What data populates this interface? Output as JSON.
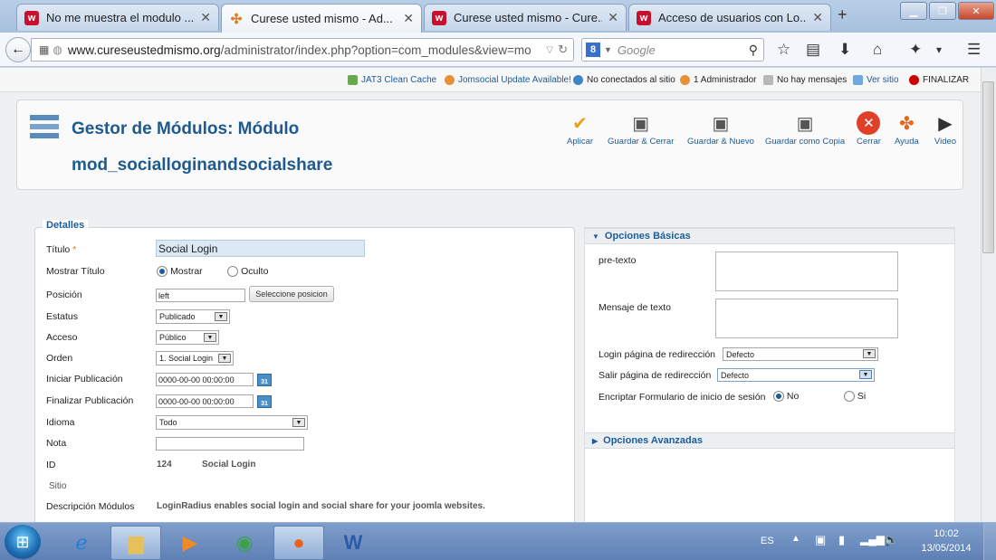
{
  "browser": {
    "tabs": [
      {
        "title": "No me muestra el modulo ...",
        "icon": "web-icon"
      },
      {
        "title": "Curese usted mismo - Ad...",
        "icon": "joomla-icon",
        "active": true
      },
      {
        "title": "Curese usted mismo - Cure...",
        "icon": "web-icon"
      },
      {
        "title": "Acceso de usuarios con Lo...",
        "icon": "web-icon"
      }
    ],
    "url_host": "www.cureseustedmismo.org",
    "url_path": "/administrator/index.php?option=com_modules&view=mo",
    "search_placeholder": "Google"
  },
  "statusbar": {
    "items": [
      "JAT3 Clean Cache",
      "Jomsocial Update Available!",
      "No conectados al sitio",
      "1 Administrador",
      "No hay mensajes",
      "Ver sitio",
      "FINALIZAR"
    ]
  },
  "toolbar": {
    "title_line1": "Gestor de Módulos: Módulo",
    "title_line2": "mod_socialloginandsocialshare",
    "buttons": [
      "Aplicar",
      "Guardar & Cerrar",
      "Guardar & Nuevo",
      "Guardar como Copia",
      "Cerrar",
      "Ayuda",
      "Video"
    ]
  },
  "details": {
    "legend": "Detalles",
    "title_label": "Título",
    "title_required": "*",
    "title_value": "Social Login",
    "show_title_label": "Mostrar Título",
    "show_option": "Mostrar",
    "hide_option": "Oculto",
    "position_label": "Posición",
    "position_value": "left",
    "select_position_btn": "Seleccione posicion",
    "status_label": "Estatus",
    "status_value": "Publicado",
    "access_label": "Acceso",
    "access_value": "Público",
    "order_label": "Orden",
    "order_value": "1. Social Login",
    "publish_up_label": "Iniciar Publicación",
    "publish_up_value": "0000-00-00 00:00:00",
    "publish_down_label": "Finalizar Publicación",
    "publish_down_value": "0000-00-00 00:00:00",
    "language_label": "Idioma",
    "language_value": "Todo",
    "note_label": "Nota",
    "id_label": "ID",
    "id_value": "124",
    "id_name": "Social Login",
    "site_label": "Sitio",
    "desc_label": "Descripción Módulos",
    "desc_value": "LoginRadius enables social login and social share for your joomla websites."
  },
  "options": {
    "basic_title": "Opciones Básicas",
    "pretext_label": "pre-texto",
    "message_label": "Mensaje de texto",
    "login_redirect_label": "Login página de redirección",
    "login_redirect_value": "Defecto",
    "logout_redirect_label": "Salir página de redirección",
    "logout_redirect_value": "Defecto",
    "encrypt_label": "Encriptar Formulario de inicio de sesión",
    "encrypt_no": "No",
    "encrypt_yes": "Si",
    "advanced_title": "Opciones Avanzadas"
  },
  "taskbar": {
    "lang": "ES",
    "time": "10:02",
    "date": "13/05/2014"
  },
  "colors": {
    "accent": "#1c5c98",
    "title": "#1e5a8d"
  }
}
